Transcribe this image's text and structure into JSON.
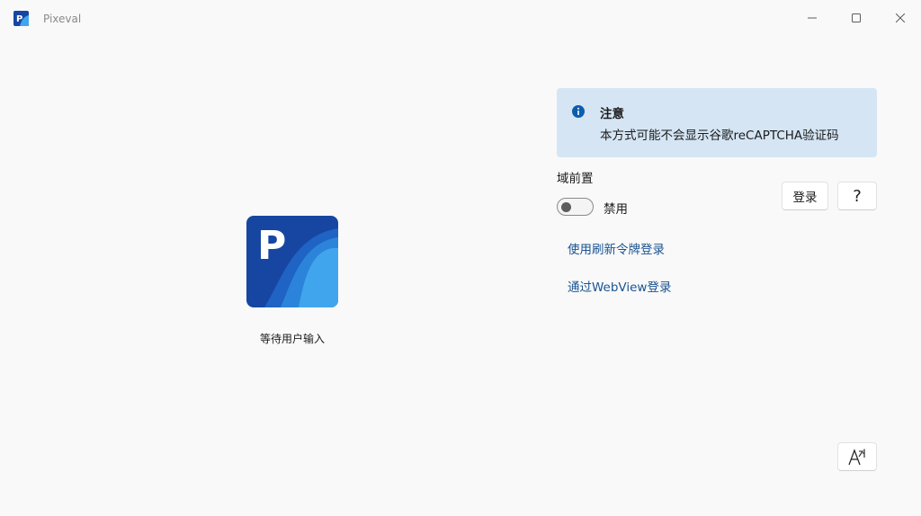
{
  "window": {
    "title": "Pixeval",
    "icon": "pixeval-app-icon",
    "controls": [
      "minimize-icon",
      "maximize-icon",
      "close-icon"
    ]
  },
  "left_panel": {
    "logo_icon": "pixeval-logo-icon",
    "logo_letter": "P",
    "status": "等待用户输入"
  },
  "info_bar": {
    "icon": "info-icon",
    "title": "注意",
    "message": "本方式可能不会显示谷歌reCAPTCHA验证码"
  },
  "domain_fronting": {
    "label": "域前置",
    "toggle_state": "禁用",
    "enabled": false
  },
  "buttons": {
    "login": "登录",
    "help": "?"
  },
  "links": {
    "refresh_token_login": "使用刷新令牌登录",
    "webview_login": "通过WebView登录"
  },
  "font_button_icon": "font-size-icon",
  "colors": {
    "accent": "#1a5491",
    "info_background": "#d5e5f4",
    "info_icon": "#0b5cad",
    "logo_dark": "#1746a2",
    "logo_light": "#41a5ee"
  }
}
